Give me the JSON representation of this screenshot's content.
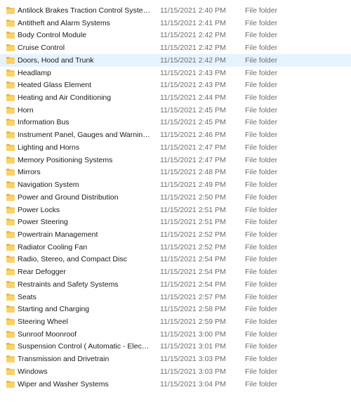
{
  "colors": {
    "folder_body": "#f9d36a",
    "folder_tab": "#e8b53f",
    "hover_background": "#e5f3ff",
    "secondary_text": "#6d6d6d"
  },
  "icons": {
    "item": "folder-icon"
  },
  "files": [
    {
      "name": "Antilock Brakes  Traction Control Systems",
      "date": "11/15/2021 2:40 PM",
      "type": "File folder"
    },
    {
      "name": "Antitheft and Alarm Systems",
      "date": "11/15/2021 2:41 PM",
      "type": "File folder"
    },
    {
      "name": "Body Control Module",
      "date": "11/15/2021 2:42 PM",
      "type": "File folder"
    },
    {
      "name": "Cruise Control",
      "date": "11/15/2021 2:42 PM",
      "type": "File folder"
    },
    {
      "name": "Doors, Hood and Trunk",
      "date": "11/15/2021 2:42 PM",
      "type": "File folder",
      "hovered": true
    },
    {
      "name": "Headlamp",
      "date": "11/15/2021 2:43 PM",
      "type": "File folder"
    },
    {
      "name": "Heated Glass Element",
      "date": "11/15/2021 2:43 PM",
      "type": "File folder"
    },
    {
      "name": "Heating and Air Conditioning",
      "date": "11/15/2021 2:44 PM",
      "type": "File folder"
    },
    {
      "name": "Horn",
      "date": "11/15/2021 2:45 PM",
      "type": "File folder"
    },
    {
      "name": "Information Bus",
      "date": "11/15/2021 2:45 PM",
      "type": "File folder"
    },
    {
      "name": "Instrument Panel, Gauges and Warning I...",
      "date": "11/15/2021 2:46 PM",
      "type": "File folder"
    },
    {
      "name": "Lighting and Horns",
      "date": "11/15/2021 2:47 PM",
      "type": "File folder"
    },
    {
      "name": "Memory Positioning Systems",
      "date": "11/15/2021 2:47 PM",
      "type": "File folder"
    },
    {
      "name": "Mirrors",
      "date": "11/15/2021 2:48 PM",
      "type": "File folder"
    },
    {
      "name": "Navigation System",
      "date": "11/15/2021 2:49 PM",
      "type": "File folder"
    },
    {
      "name": "Power and Ground Distribution",
      "date": "11/15/2021 2:50 PM",
      "type": "File folder"
    },
    {
      "name": "Power Locks",
      "date": "11/15/2021 2:51 PM",
      "type": "File folder"
    },
    {
      "name": "Power Steering",
      "date": "11/15/2021 2:51 PM",
      "type": "File folder"
    },
    {
      "name": "Powertrain Management",
      "date": "11/15/2021 2:52 PM",
      "type": "File folder"
    },
    {
      "name": "Radiator Cooling Fan",
      "date": "11/15/2021 2:52 PM",
      "type": "File folder"
    },
    {
      "name": "Radio, Stereo, and Compact Disc",
      "date": "11/15/2021 2:54 PM",
      "type": "File folder"
    },
    {
      "name": "Rear Defogger",
      "date": "11/15/2021 2:54 PM",
      "type": "File folder"
    },
    {
      "name": "Restraints and Safety Systems",
      "date": "11/15/2021 2:54 PM",
      "type": "File folder"
    },
    {
      "name": "Seats",
      "date": "11/15/2021 2:57 PM",
      "type": "File folder"
    },
    {
      "name": "Starting and Charging",
      "date": "11/15/2021 2:58 PM",
      "type": "File folder"
    },
    {
      "name": "Steering Wheel",
      "date": "11/15/2021 2:59 PM",
      "type": "File folder"
    },
    {
      "name": "Sunroof  Moonroof",
      "date": "11/15/2021 3:00 PM",
      "type": "File folder"
    },
    {
      "name": "Suspension Control ( Automatic - Electro...",
      "date": "11/15/2021 3:01 PM",
      "type": "File folder"
    },
    {
      "name": "Transmission and Drivetrain",
      "date": "11/15/2021 3:03 PM",
      "type": "File folder"
    },
    {
      "name": "Windows",
      "date": "11/15/2021 3:03 PM",
      "type": "File folder"
    },
    {
      "name": "Wiper and Washer Systems",
      "date": "11/15/2021 3:04 PM",
      "type": "File folder"
    }
  ]
}
